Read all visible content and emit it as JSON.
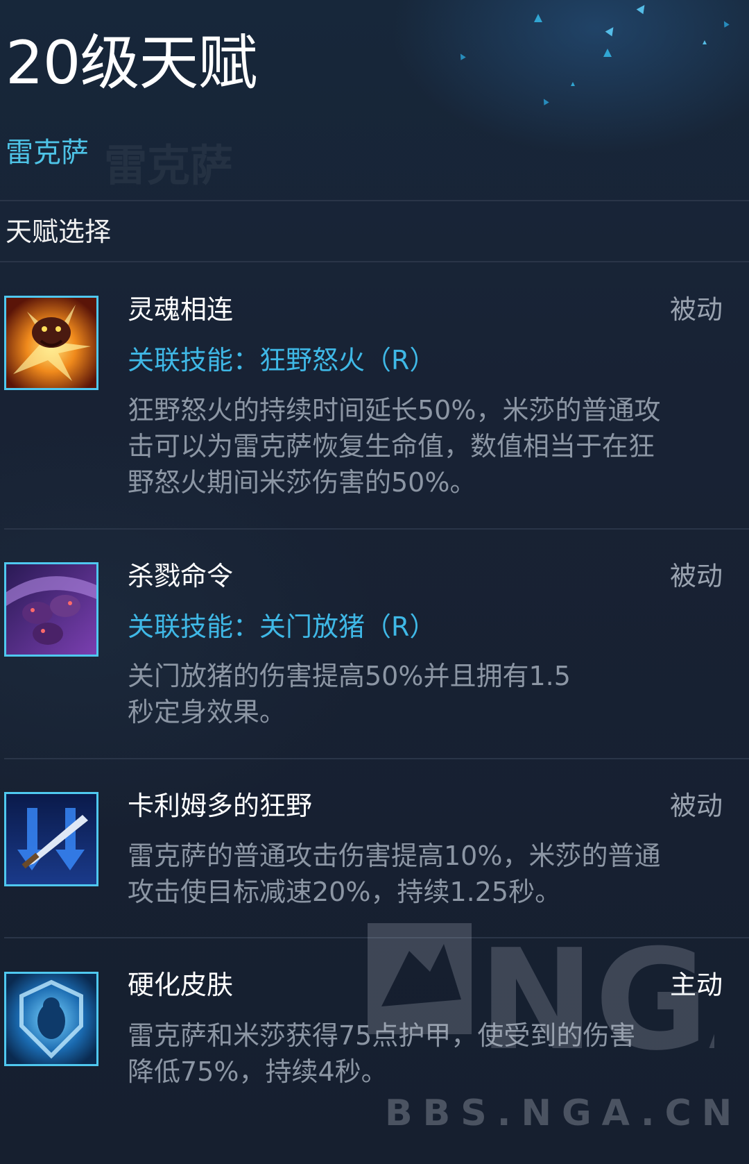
{
  "page": {
    "title": "20级天赋",
    "hero_name": "雷克萨",
    "section_label": "天赋选择"
  },
  "talents": [
    {
      "name": "灵魂相连",
      "type": "被动",
      "skill": "关联技能：狂野怒火（R）",
      "desc_lines": [
        "狂野怒火的持续时间延长50%，米莎的普通攻",
        "击可以为雷克萨恢复生命值，数值相当于在狂",
        "野怒火期间米莎伤害的50%。"
      ],
      "icon": "bear-fire-icon"
    },
    {
      "name": "杀戮命令",
      "type": "被动",
      "skill": "关联技能：关门放猪（R）",
      "desc_lines": [
        "关门放猪的伤害提高50%并且拥有1.5",
        "秒定身效果。"
      ],
      "icon": "boars-icon"
    },
    {
      "name": "卡利姆多的狂野",
      "type": "被动",
      "desc_lines": [
        "雷克萨的普通攻击伤害提高10%，米莎的普通",
        "攻击使目标减速20%，持续1.25秒。"
      ],
      "icon": "sword-arrows-icon"
    },
    {
      "name": "硬化皮肤",
      "type": "主动",
      "desc_lines": [
        "雷克萨和米莎获得75点护甲，使受到的伤害",
        "降低75%，持续4秒。"
      ],
      "icon": "bear-shield-icon"
    }
  ],
  "watermark": {
    "logo_text": "NGA",
    "url": "BBS.NGA.CN"
  },
  "colors": {
    "background": "#151d2c",
    "accent": "#3fb8e6",
    "icon_border": "#4fc8ef",
    "muted_text": "#8c96a4"
  }
}
